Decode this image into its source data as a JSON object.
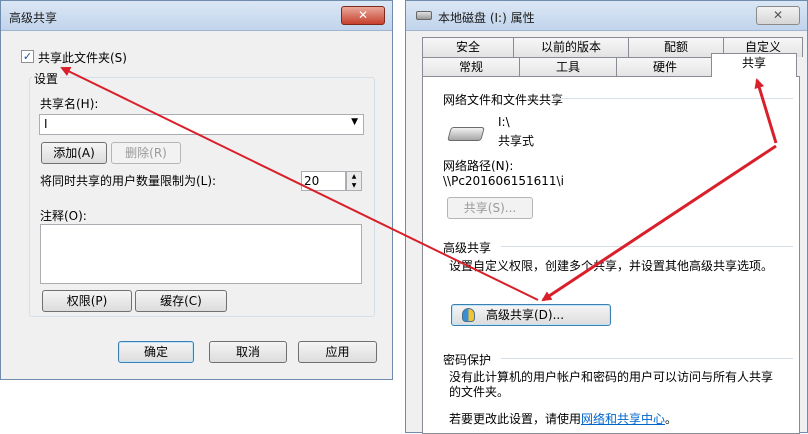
{
  "adv": {
    "title": "高级共享",
    "close": "✕",
    "share_cb": "共享此文件夹(S)",
    "settings": "设置",
    "share_name_label": "共享名(H):",
    "share_name_value": "I",
    "add_btn": "添加(A)",
    "remove_btn": "删除(R)",
    "limit_label": "将同时共享的用户数量限制为(L):",
    "limit_value": "20",
    "comment_label": "注释(O):",
    "perm_btn": "权限(P)",
    "cache_btn": "缓存(C)",
    "ok_btn": "确定",
    "cancel_btn": "取消",
    "apply_btn": "应用"
  },
  "props": {
    "title": "本地磁盘 (I:) 属性",
    "close": "✕",
    "tabs_row1": [
      "安全",
      "以前的版本",
      "配额",
      "自定义"
    ],
    "tabs_row2": [
      "常规",
      "工具",
      "硬件",
      "共享"
    ],
    "net_section": "网络文件和文件夹共享",
    "drive_name": "I:\\",
    "drive_status": "共享式",
    "net_path_label": "网络路径(N):",
    "net_path_value": "\\\\Pc201606151611\\i",
    "share_btn": "共享(S)...",
    "adv_section": "高级共享",
    "adv_desc": "设置自定义权限，创建多个共享，并设置其他高级共享选项。",
    "adv_btn": "高级共享(D)...",
    "pw_section": "密码保护",
    "pw_desc": "没有此计算机的用户帐户和密码的用户可以访问与所有人共享的文件夹。",
    "pw_change_pre": "若要更改此设置，请使用",
    "pw_link": "网络和共享中心",
    "pw_change_post": "。"
  },
  "colors": {
    "arrow": "#d9202a",
    "link": "#0066cc"
  }
}
